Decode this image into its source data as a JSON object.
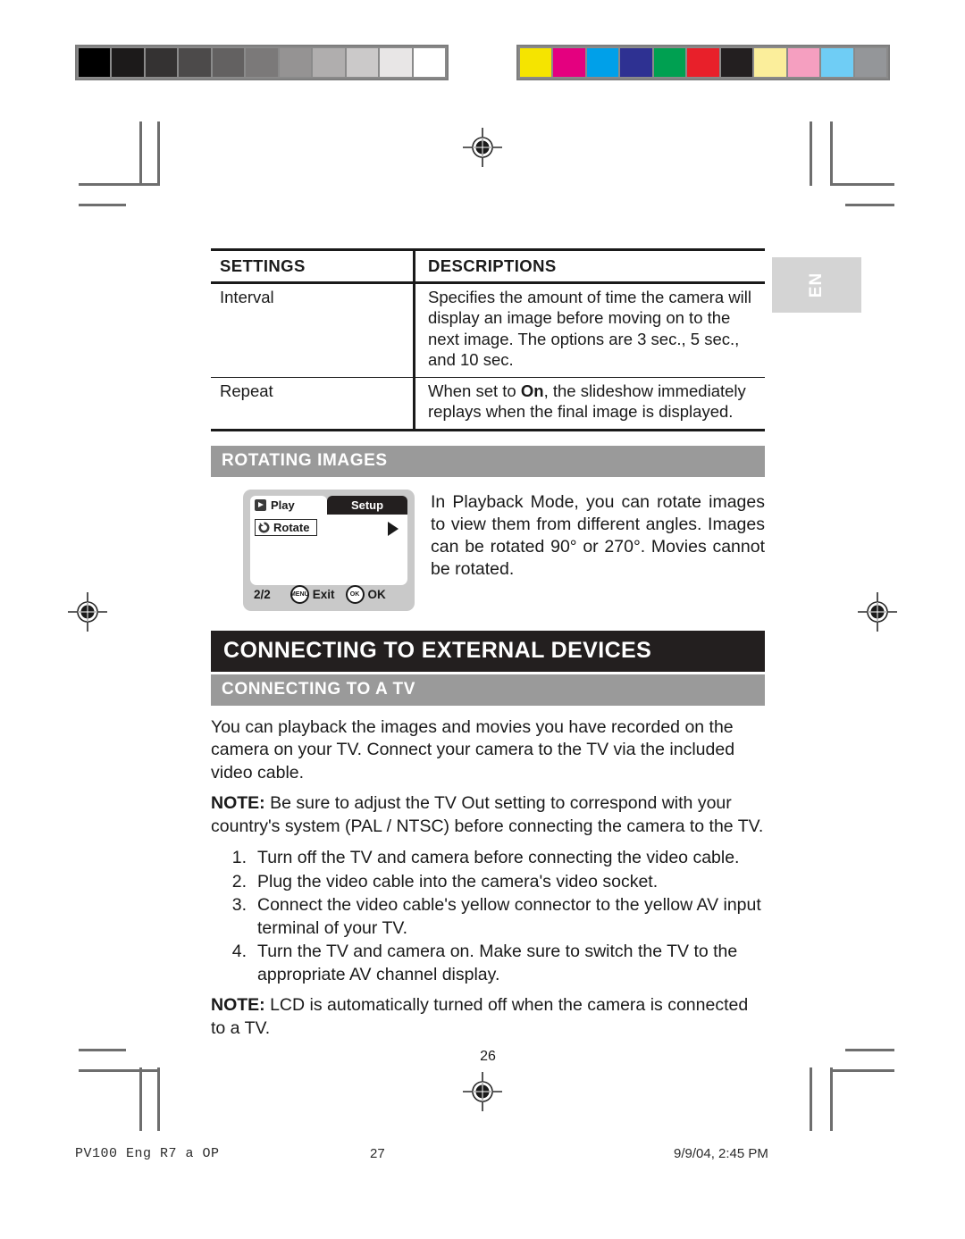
{
  "calibration": {
    "gray_patches": [
      "#000000",
      "#1c1a1a",
      "#343232",
      "#4c4a4a",
      "#636161",
      "#7b7979",
      "#959393",
      "#b0aeae",
      "#cbc9c9",
      "#e8e6e6",
      "#ffffff"
    ],
    "color_patches": [
      "#f5e400",
      "#e4007f",
      "#00a0e9",
      "#2e3192",
      "#00a051",
      "#e8202a",
      "#231f20",
      "#fbee9b",
      "#f59fc0",
      "#6fcdf5",
      "#949699"
    ]
  },
  "language_tab": {
    "label": "EN"
  },
  "table": {
    "headers": [
      "SETTINGS",
      "DESCRIPTIONS"
    ],
    "rows": [
      {
        "setting": "Interval",
        "description": "Specifies the amount of time the camera will display an image before moving on to the next image. The options are 3 sec., 5 sec., and 10 sec."
      },
      {
        "setting": "Repeat",
        "description_pre": "When set to ",
        "description_bold": "On",
        "description_post": ", the slideshow immediately replays when the final image is displayed."
      }
    ]
  },
  "rotating_section": {
    "heading": "ROTATING IMAGES",
    "body": "In Playback Mode, you can rotate images to view them from different angles. Images can be rotated 90° or 270°. Movies cannot be rotated.",
    "lcd": {
      "tab_play": "Play",
      "tab_setup": "Setup",
      "menu_item": "Rotate",
      "page_indicator": "2/2",
      "menu_button": "MENU",
      "menu_button_label": "Exit",
      "ok_button": "OK",
      "ok_button_label": "OK"
    }
  },
  "chapter": {
    "heading": "CONNECTING TO EXTERNAL DEVICES",
    "subheading": "CONNECTING TO A TV",
    "intro": "You can playback the images and movies you have recorded on the camera on your TV. Connect your camera to the TV via the included video cable.",
    "note1_label": "NOTE:",
    "note1_text": " Be sure to adjust the TV Out setting to correspond with your country's system (PAL / NTSC) before connecting the camera to the TV.",
    "steps": [
      {
        "num": "1.",
        "text": "Turn off the TV and camera before connecting the video cable."
      },
      {
        "num": "2.",
        "text": "Plug the video cable into the camera's video socket."
      },
      {
        "num": "3.",
        "text": "Connect the video cable's yellow connector to the yellow AV input terminal of your TV."
      },
      {
        "num": "4.",
        "text": "Turn the TV and camera on. Make sure to switch the TV to the appropriate AV channel display."
      }
    ],
    "note2_label": "NOTE:",
    "note2_text": " LCD is automatically turned off when the camera is connected to a TV."
  },
  "page_number": "26",
  "footer": {
    "job_name": "PV100 Eng R7 a OP",
    "sheet_number": "27",
    "timestamp": "9/9/04, 2:45 PM"
  }
}
